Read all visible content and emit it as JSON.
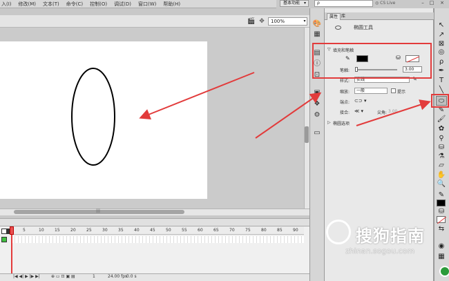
{
  "menubar": {
    "items": [
      "入(I)",
      "修改(M)",
      "文本(T)",
      "命令(C)",
      "控制(O)",
      "调试(D)",
      "窗口(W)",
      "帮助(H)"
    ]
  },
  "topbar": {
    "workspace": "基本功能",
    "workspace_arrow": "▾",
    "search_glyph": "ρ",
    "cslive": "CS Live",
    "minimize": "–",
    "restore": "□",
    "close": "×"
  },
  "stagebar": {
    "zoom": "100%",
    "zoom_arrow": "▾"
  },
  "scroll": {
    "hmid": "|||"
  },
  "timeline": {
    "frame_ticks": [
      "5",
      "10",
      "15",
      "20",
      "25",
      "30",
      "35",
      "40",
      "45",
      "50",
      "55",
      "60",
      "65",
      "70",
      "75",
      "80",
      "85",
      "90"
    ],
    "footer_fps": "24.00 fps",
    "footer_time": "0.0 s",
    "footer_frame": "1"
  },
  "properties": {
    "tabs": [
      "属性",
      "库"
    ],
    "tool_name": "椭圆工具",
    "fill_stroke_section": "填充和笔触",
    "stroke_label": "笔触:",
    "stroke_value": "3.00",
    "style_label": "样式:",
    "style_value": "实线",
    "scale_label": "缩放:",
    "scale_value": "一般",
    "hint_label": "提示",
    "cap_label": "端点:",
    "join_label": "接合:",
    "miter_label": "尖角:",
    "miter_value": "3.00",
    "ellipse_options": "椭圆选项"
  },
  "watermark": {
    "brand": "搜狗指南",
    "url": "zhinan.sogou.com"
  },
  "colors": {
    "annotation_red": "#e23b3b",
    "stage_bg": "#ffffff",
    "fill_color": "#000000"
  },
  "icons": {
    "ellipse_tool": "ellipse-tool-icon",
    "pencil": "pencil-icon",
    "paint_bucket": "paint-bucket-icon"
  }
}
